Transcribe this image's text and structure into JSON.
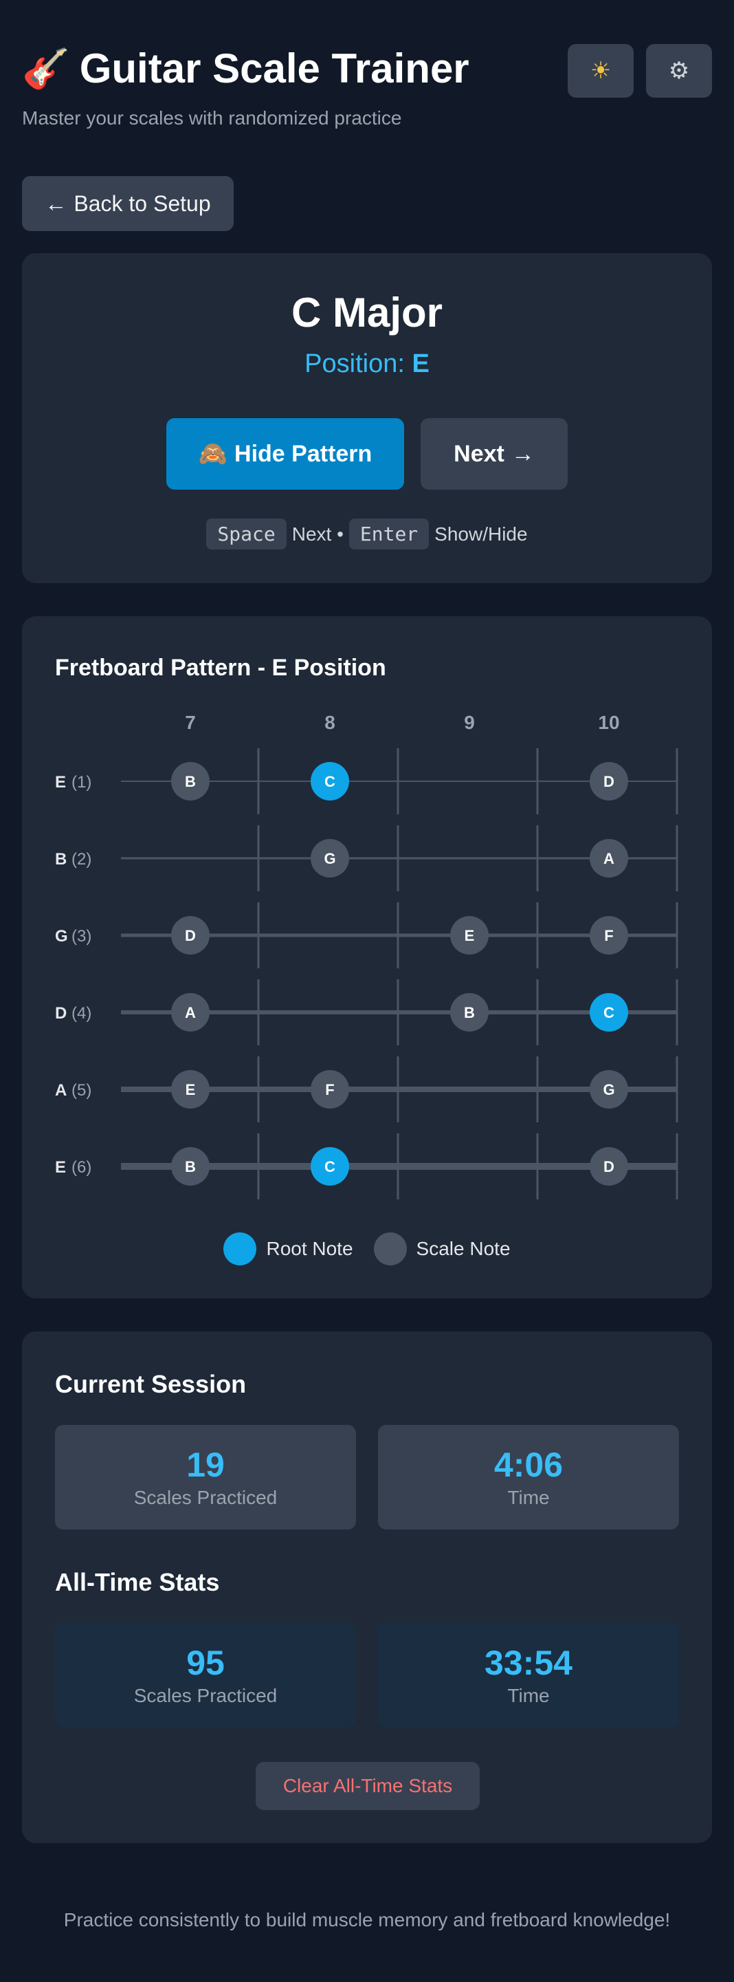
{
  "header": {
    "emoji": "🎸",
    "title": "Guitar Scale Trainer",
    "subtitle": "Master your scales with randomized practice",
    "theme_icon": "sun-icon",
    "settings_icon": "gear-icon"
  },
  "nav": {
    "back_label": "Back to Setup"
  },
  "scale": {
    "name": "C Major",
    "position_prefix": "Position:",
    "position_value": "E",
    "hide_label": "Hide Pattern",
    "hide_emoji": "🙈",
    "next_label": "Next",
    "shortcut_1_key": "Space",
    "shortcut_1_text": "Next •",
    "shortcut_2_key": "Enter",
    "shortcut_2_text": "Show/Hide"
  },
  "fretboard": {
    "title": "Fretboard Pattern - E Position",
    "frets": [
      "7",
      "8",
      "9",
      "10"
    ],
    "strings": [
      {
        "name": "E",
        "number": "(1)",
        "notes": [
          {
            "fret": 7,
            "note": "B",
            "root": false
          },
          {
            "fret": 8,
            "note": "C",
            "root": true
          },
          {
            "fret": 10,
            "note": "D",
            "root": false
          }
        ]
      },
      {
        "name": "B",
        "number": "(2)",
        "notes": [
          {
            "fret": 8,
            "note": "G",
            "root": false
          },
          {
            "fret": 10,
            "note": "A",
            "root": false
          }
        ]
      },
      {
        "name": "G",
        "number": "(3)",
        "notes": [
          {
            "fret": 7,
            "note": "D",
            "root": false
          },
          {
            "fret": 9,
            "note": "E",
            "root": false
          },
          {
            "fret": 10,
            "note": "F",
            "root": false
          }
        ]
      },
      {
        "name": "D",
        "number": "(4)",
        "notes": [
          {
            "fret": 7,
            "note": "A",
            "root": false
          },
          {
            "fret": 9,
            "note": "B",
            "root": false
          },
          {
            "fret": 10,
            "note": "C",
            "root": true
          }
        ]
      },
      {
        "name": "A",
        "number": "(5)",
        "notes": [
          {
            "fret": 7,
            "note": "E",
            "root": false
          },
          {
            "fret": 8,
            "note": "F",
            "root": false
          },
          {
            "fret": 10,
            "note": "G",
            "root": false
          }
        ]
      },
      {
        "name": "E",
        "number": "(6)",
        "notes": [
          {
            "fret": 7,
            "note": "B",
            "root": false
          },
          {
            "fret": 8,
            "note": "C",
            "root": true
          },
          {
            "fret": 10,
            "note": "D",
            "root": false
          }
        ]
      }
    ],
    "legend_root": "Root Note",
    "legend_scale": "Scale Note",
    "colors": {
      "root": "#0ea5e9",
      "scale": "#4b5563",
      "string": "#4b5563",
      "fret_line": "#4b5563"
    }
  },
  "session": {
    "title": "Current Session",
    "scales_value": "19",
    "scales_label": "Scales Practiced",
    "time_value": "4:06",
    "time_label": "Time"
  },
  "alltime": {
    "title": "All-Time Stats",
    "scales_value": "95",
    "scales_label": "Scales Practiced",
    "time_value": "33:54",
    "time_label": "Time",
    "clear_label": "Clear All-Time Stats"
  },
  "footer": {
    "text": "Practice consistently to build muscle memory and fretboard knowledge!"
  }
}
